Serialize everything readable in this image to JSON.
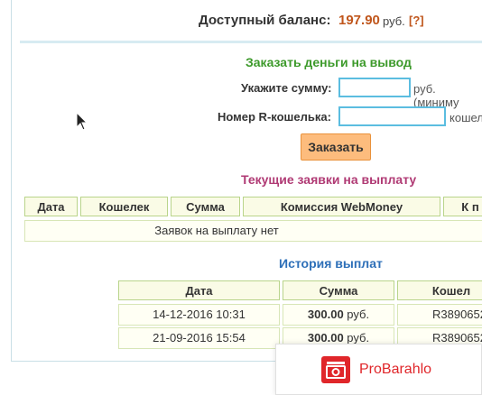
{
  "balance": {
    "label": "Доступный баланс:",
    "amount": "197.90",
    "currency": "руб.",
    "help": "[?]"
  },
  "withdraw": {
    "title": "Заказать деньги на вывод",
    "amount_label": "Укажите сумму:",
    "amount_value": "",
    "amount_hint": "руб. (миниму",
    "wallet_label": "Номер R-кошелька:",
    "wallet_value": "",
    "wallet_hint": "кошел",
    "order_button": "Заказать"
  },
  "current_requests": {
    "title": "Текущие заявки на выплату",
    "columns": [
      "Дата",
      "Кошелек",
      "Сумма",
      "Комиссия WebMoney",
      "К п"
    ],
    "empty_text": "Заявок на выплату нет"
  },
  "history": {
    "title": "История выплат",
    "columns": [
      "Дата",
      "Сумма",
      "Кошел"
    ],
    "rows": [
      {
        "date": "14-12-2016 10:31",
        "amount": "300.00",
        "currency": "руб.",
        "wallet": "R3890652"
      },
      {
        "date": "21-09-2016 15:54",
        "amount": "300.00",
        "currency": "руб.",
        "wallet": "R3890652"
      }
    ]
  },
  "ad": {
    "text": "ProBarahlo",
    "icon": "probarahlo-logo-icon"
  },
  "colors": {
    "amount": "#c0561c",
    "green_heading": "#3d9a2b",
    "pink_heading": "#b03a74",
    "blue_heading": "#2d6fb8",
    "button": "#fdbc7d",
    "input_border": "#5bbde0",
    "brand_red": "#e0262a"
  }
}
